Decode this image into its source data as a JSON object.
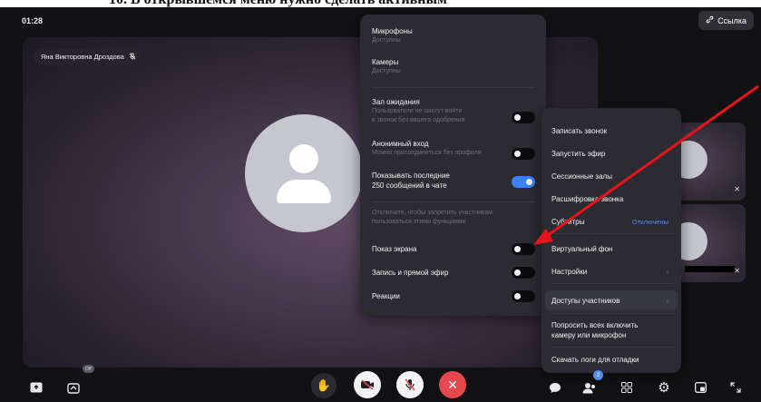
{
  "doc_fragment": "10.     В открывшемся меню нужно сделать активным",
  "header": {
    "timer": "01:28",
    "link_label": "Ссылка"
  },
  "main_video": {
    "participant_name": "Яна Викторовна Дроздова"
  },
  "settings_panel": {
    "microphones": {
      "title": "Микрофоны",
      "sub": "Доступны"
    },
    "cameras": {
      "title": "Камеры",
      "sub": "Доступны"
    },
    "waiting_room": {
      "title": "Зал ожидания",
      "sub1": "Пользователи не смогут войти",
      "sub2": "в звонок без вашего одобрения",
      "enabled": false
    },
    "anonymous": {
      "title": "Анонимный вход",
      "sub": "Можно присоединиться без профиля",
      "enabled": false
    },
    "show_last": {
      "title1": "Показывать последние",
      "title2": "250 сообщений в чате",
      "enabled": true
    },
    "hint1": "Отключите, чтобы запретить участникам",
    "hint2": "пользоваться этими функциями",
    "screen_share": {
      "title": "Показ экрана",
      "enabled": false
    },
    "recording": {
      "title": "Запись и прямой эфир",
      "enabled": false
    },
    "reactions": {
      "title": "Реакции",
      "enabled": false
    }
  },
  "call_menu": {
    "record": "Записать звонок",
    "broadcast": "Запустить эфир",
    "sessions": "Сессионные залы",
    "transcript": "Расшифровка звонка",
    "subtitles": "Субтитры",
    "subtitles_state": "Отключены",
    "virtual_bg": "Виртуальный фон",
    "settings": "Настройки",
    "access": "Доступы участников",
    "ask_all1": "Попросить всех включить",
    "ask_all2": "камеру или микрофон",
    "download_logs": "Скачать логи для отладки"
  },
  "bottom_bar": {
    "participants_count": "2",
    "effects_badge": "Off"
  },
  "colors": {
    "background": "#121214",
    "panel": "#2b2b31",
    "accent_blue": "#3b82f6",
    "end_call_red": "#e5484d",
    "annotation_arrow": "#e8141c"
  },
  "icons": [
    "link-icon",
    "mic-off-icon",
    "screen-share-icon",
    "effects-icon",
    "raise-hand-icon",
    "camera-off-icon",
    "mic-off-icon",
    "end-call-icon",
    "chat-icon",
    "participants-icon",
    "grid-icon",
    "gear-icon",
    "layout-icon",
    "fullscreen-icon"
  ]
}
